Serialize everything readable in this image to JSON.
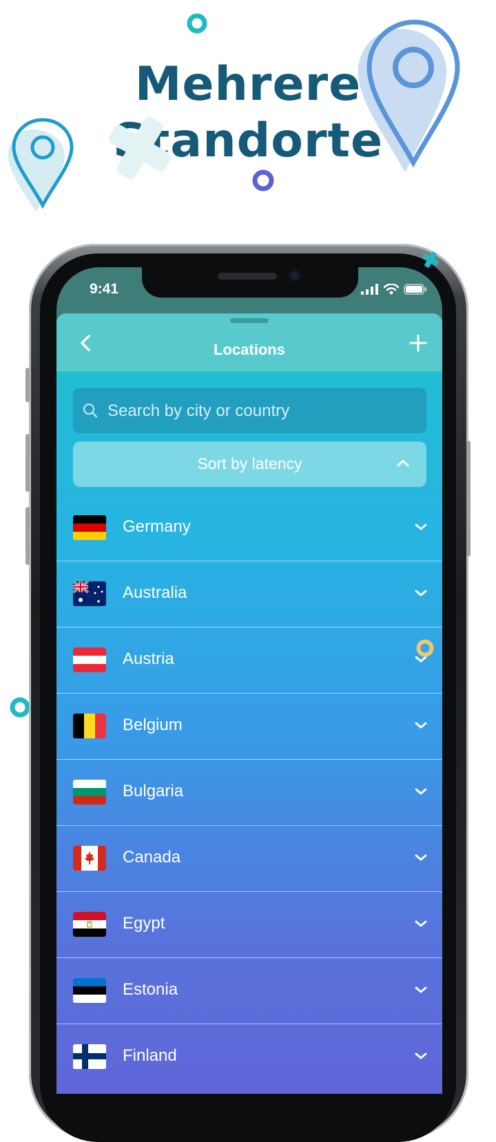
{
  "headline": {
    "line1": "Mehrere",
    "line2": "Standorte"
  },
  "status_bar": {
    "time": "9:41"
  },
  "header": {
    "title": "Locations"
  },
  "search": {
    "placeholder": "Search by city or country"
  },
  "sort": {
    "label": "Sort by latency"
  },
  "countries": [
    {
      "name": "Germany"
    },
    {
      "name": "Australia"
    },
    {
      "name": "Austria"
    },
    {
      "name": "Belgium"
    },
    {
      "name": "Bulgaria"
    },
    {
      "name": "Canada"
    },
    {
      "name": "Egypt"
    },
    {
      "name": "Estonia"
    },
    {
      "name": "Finland"
    }
  ],
  "colors": {
    "headline": "#155a78",
    "header_bar": "#58cacd",
    "search_bg": "#229ebf",
    "sort_bg": "#7dd8e6",
    "gradient_top": "#1fc1cf",
    "gradient_bottom": "#6166d8"
  },
  "icons": {
    "back": "chevron-left-icon",
    "add": "plus-icon",
    "search": "search-icon",
    "sort_toggle": "chevron-up-icon",
    "row_expand": "chevron-down-icon"
  }
}
